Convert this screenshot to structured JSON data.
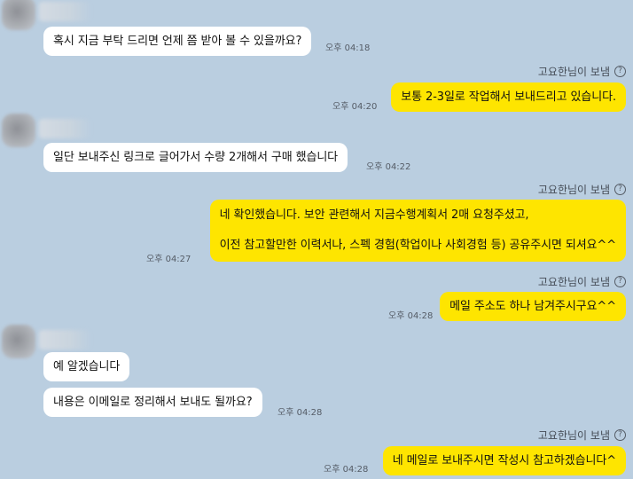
{
  "messages": [
    {
      "side": "in",
      "text": "혹시 지금 부탁 드리면 언제 쯤 받아 볼 수 있을까요?",
      "time": "오후 04:18"
    },
    {
      "side": "out",
      "sender": "고요한님이 보냄",
      "text": "보통 2-3일로 작업해서 보내드리고 있습니다.",
      "time": "오후 04:20"
    },
    {
      "side": "in",
      "text": "일단 보내주신 링크로 글어가서 수량 2개해서 구매 했습니다",
      "time": "오후 04:22"
    },
    {
      "side": "out",
      "sender": "고요한님이 보냄",
      "lines": [
        "네 확인했습니다. 보안 관련해서 지금수행계획서 2매 요청주셨고,",
        "이전 참고할만한 이력서나, 스펙 경험(학업이나 사회경험 등) 공유주시면 되셔요^^"
      ],
      "time": "오후 04:27"
    },
    {
      "side": "out",
      "sender": "고요한님이 보냄",
      "text": "메일 주소도 하나 남겨주시구요^^",
      "time": "오후 04:28"
    },
    {
      "side": "in",
      "text": "예 알겠습니다",
      "time": ""
    },
    {
      "side": "in",
      "text": "내용은 이메일로 정리해서 보내도 될까요?",
      "time": "오후 04:28"
    },
    {
      "side": "out",
      "sender": "고요한님이 보냄",
      "text": "네 메일로 보내주시면 작성시 참고하겠습니다^",
      "time": "오후 04:28"
    }
  ],
  "icons": {
    "sender_info": "question-circle-icon",
    "sender_info_glyph": "?"
  },
  "colors": {
    "background": "#bacee0",
    "incoming_bubble": "#ffffff",
    "outgoing_bubble": "#fee500"
  }
}
